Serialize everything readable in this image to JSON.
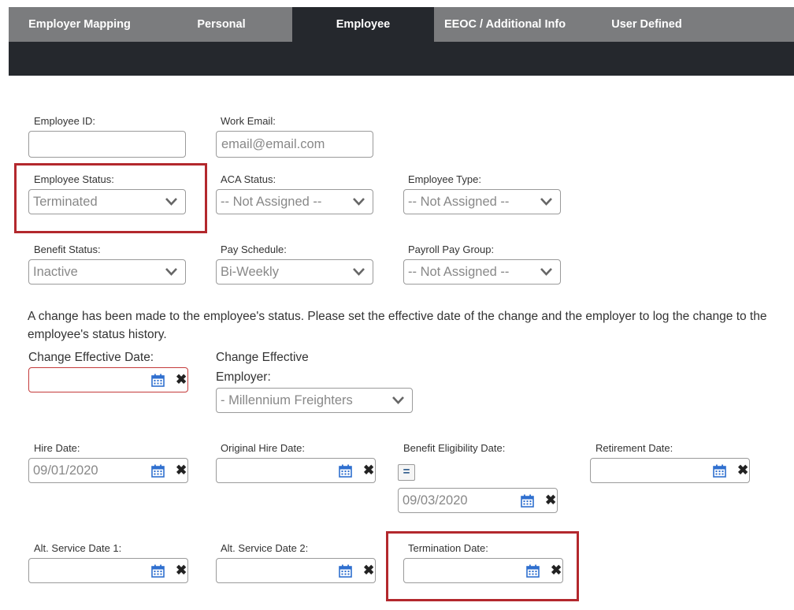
{
  "tabs": [
    {
      "label": "Employer Mapping"
    },
    {
      "label": "Personal"
    },
    {
      "label": "Employee"
    },
    {
      "label": "EEOC / Additional Info"
    },
    {
      "label": "User Defined"
    }
  ],
  "fields": {
    "employee_id": {
      "label": "Employee ID:",
      "value": ""
    },
    "work_email": {
      "label": "Work Email:",
      "placeholder": "email@email.com"
    },
    "employee_status": {
      "label": "Employee Status:",
      "value": "Terminated"
    },
    "aca_status": {
      "label": "ACA Status:",
      "value": "-- Not Assigned --"
    },
    "employee_type": {
      "label": "Employee Type:",
      "value": "-- Not Assigned --"
    },
    "benefit_status": {
      "label": "Benefit Status:",
      "value": "Inactive"
    },
    "pay_schedule": {
      "label": "Pay Schedule:",
      "value": "Bi-Weekly"
    },
    "payroll_pay_group": {
      "label": "Payroll Pay Group:",
      "value": "-- Not Assigned --"
    },
    "change_effective_date": {
      "label": "Change Effective Date:",
      "value": ""
    },
    "change_effective_employer": {
      "label_line1": "Change Effective",
      "label_line2": "Employer:",
      "value": "- Millennium Freighters"
    },
    "hire_date": {
      "label": "Hire Date:",
      "value": "09/01/2020"
    },
    "original_hire_date": {
      "label": "Original Hire Date:",
      "value": ""
    },
    "benefit_eligibility_date": {
      "label": "Benefit Eligibility Date:",
      "value": "09/03/2020",
      "eq_label": "="
    },
    "retirement_date": {
      "label": "Retirement Date:",
      "value": ""
    },
    "alt_service_date_1": {
      "label": "Alt. Service Date 1:",
      "value": ""
    },
    "alt_service_date_2": {
      "label": "Alt. Service Date 2:",
      "value": ""
    },
    "termination_date": {
      "label": "Termination Date:",
      "value": ""
    }
  },
  "message": "A change has been made to the employee's status. Please set the effective date of the change and the employer to log the change to the employee's status history.",
  "icons": {
    "clear": "✖"
  },
  "colors": {
    "tabbar": "#7b7c7e",
    "active_tab": "#25282d",
    "highlight": "#b3282d",
    "error_border": "#c43b3b",
    "calendar": "#2f6fcf"
  }
}
